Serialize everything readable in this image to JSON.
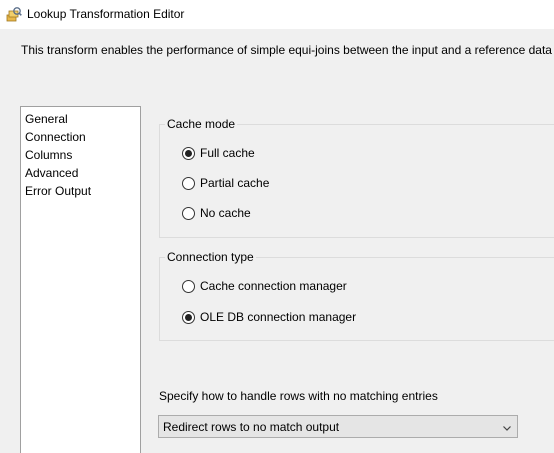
{
  "window": {
    "title": "Lookup Transformation Editor",
    "icon": "lookup-transform-icon"
  },
  "description": "This transform enables the performance of simple equi-joins between the input and a reference data set.",
  "nav": {
    "items": [
      "General",
      "Connection",
      "Columns",
      "Advanced",
      "Error Output"
    ],
    "selected": "General"
  },
  "cache_mode": {
    "title": "Cache mode",
    "options": [
      "Full cache",
      "Partial cache",
      "No cache"
    ],
    "selected": "Full cache"
  },
  "connection_type": {
    "title": "Connection type",
    "options": [
      "Cache connection manager",
      "OLE DB connection manager"
    ],
    "selected": "OLE DB connection manager"
  },
  "no_match": {
    "prompt": "Specify how to handle rows with no matching entries",
    "selected_value": "Redirect rows to no match output"
  }
}
